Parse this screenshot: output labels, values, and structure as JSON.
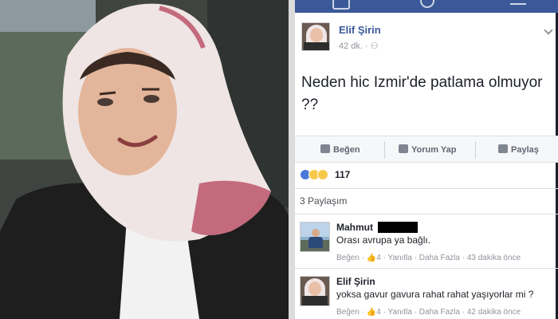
{
  "photo": {
    "subject": "",
    "colors": {
      "background": "#3a3f3a",
      "scarf": "#efe5e5",
      "scarf_accent": "#c46a7d",
      "dress": "#1f1f1f"
    }
  },
  "nav": {
    "icons": [
      "home-icon",
      "globe-icon",
      "menu-icon"
    ],
    "color": "#3b5998"
  },
  "post": {
    "author": "Elif Şirin",
    "time": "42 dk.",
    "privacy_icon": "friends-icon",
    "text": "Neden hic Izmir'de patlama olmuyor ??",
    "actions": {
      "like": "Beğen",
      "comment": "Yorum Yap",
      "share": "Paylaş"
    },
    "reactions": {
      "types": [
        "like",
        "haha",
        "wow"
      ],
      "count": "117"
    },
    "shares": "3 Paylaşım"
  },
  "comments": [
    {
      "author": "Mahmut",
      "text": "Orası avrupa ya bağlı.",
      "meta": "Beğen · 👍4 · Yanıtla · Daha Fazla · 43 dakika önce"
    },
    {
      "author": "Elif Şirin",
      "text": "yoksa gavur gavura rahat rahat yaşıyorlar mi ?",
      "meta": "Beğen · 👍4 · Yanıtla · Daha Fazla · 42 dakika önce"
    }
  ]
}
